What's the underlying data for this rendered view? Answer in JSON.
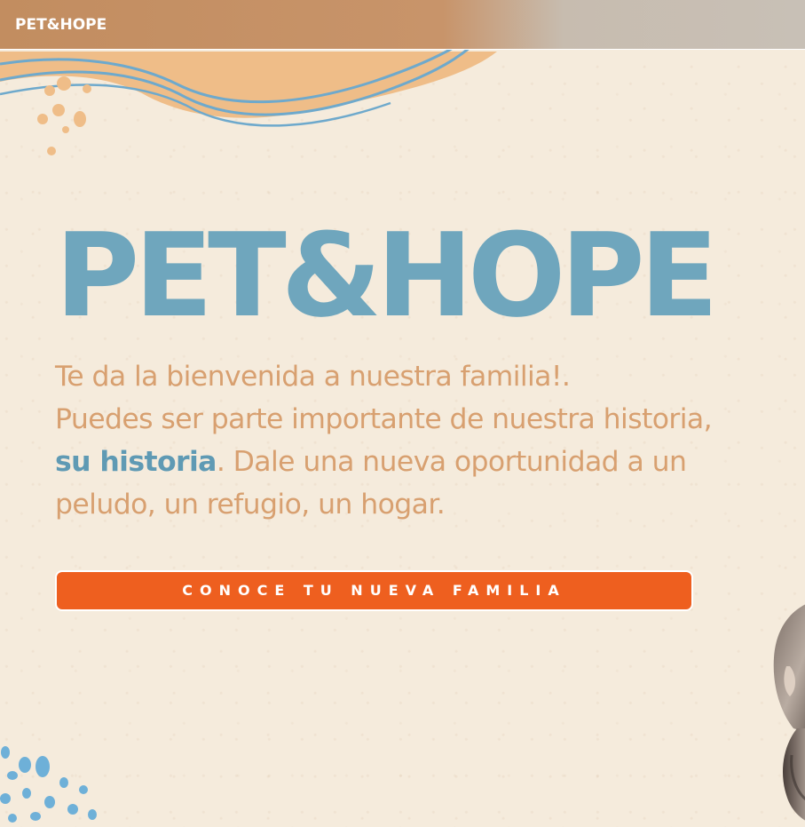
{
  "header": {
    "brand": "PET&HOPE"
  },
  "hero": {
    "title": "PET&HOPE",
    "line1": "Te da la bienvenida a nuestra familia!.",
    "line2": "Puedes ser parte importante de nuestra historia,",
    "highlight": "su historia",
    "line3_rest": ". Dale una nueva oportunidad a un",
    "line4": "peludo, un refugio, un hogar.",
    "cta_label": "CONOCE TU NUEVA FAMILIA"
  },
  "colors": {
    "background": "#f5ebdc",
    "title_blue": "#6fa6bd",
    "text_orange": "#d8a070",
    "highlight_blue": "#5f9ab4",
    "cta_orange": "#ee5f1f",
    "blob_orange": "#efbd88",
    "dot_blue": "#6eb0d8"
  },
  "icons": {
    "top_decoration": "wave-blob-decoration",
    "bottom_decoration": "dot-cluster-decoration",
    "pet": "pet-photo"
  }
}
